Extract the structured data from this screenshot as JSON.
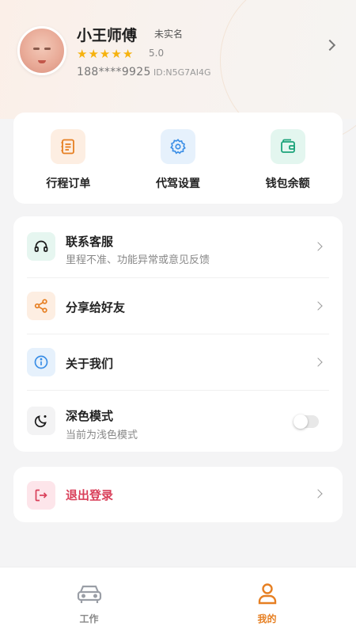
{
  "profile": {
    "name": "小王师傅",
    "realname_status": "未实名",
    "rating": "5.0",
    "star_count": 5,
    "phone": "188****9925",
    "id_text": "ID:N5G7AI4G"
  },
  "quick_actions": [
    {
      "label": "行程订单",
      "icon": "order-list-icon",
      "color": "#e67f22"
    },
    {
      "label": "代驾设置",
      "icon": "gear-icon",
      "color": "#3a8ee6"
    },
    {
      "label": "钱包余额",
      "icon": "wallet-icon",
      "color": "#1ba37a"
    }
  ],
  "menu": {
    "contact": {
      "title": "联系客服",
      "subtitle": "里程不准、功能异常或意见反馈",
      "icon": "headset-icon"
    },
    "share": {
      "title": "分享给好友",
      "icon": "share-icon"
    },
    "about": {
      "title": "关于我们",
      "icon": "info-icon"
    },
    "dark_mode": {
      "title": "深色模式",
      "subtitle": "当前为浅色模式",
      "icon": "moon-icon",
      "enabled": false
    }
  },
  "logout": {
    "label": "退出登录",
    "icon": "logout-icon",
    "color": "#d9405a"
  },
  "tabbar": {
    "items": [
      {
        "label": "工作",
        "icon": "car-icon",
        "active": false
      },
      {
        "label": "我的",
        "icon": "user-icon",
        "active": true
      }
    ],
    "active_color": "#e67f22"
  }
}
